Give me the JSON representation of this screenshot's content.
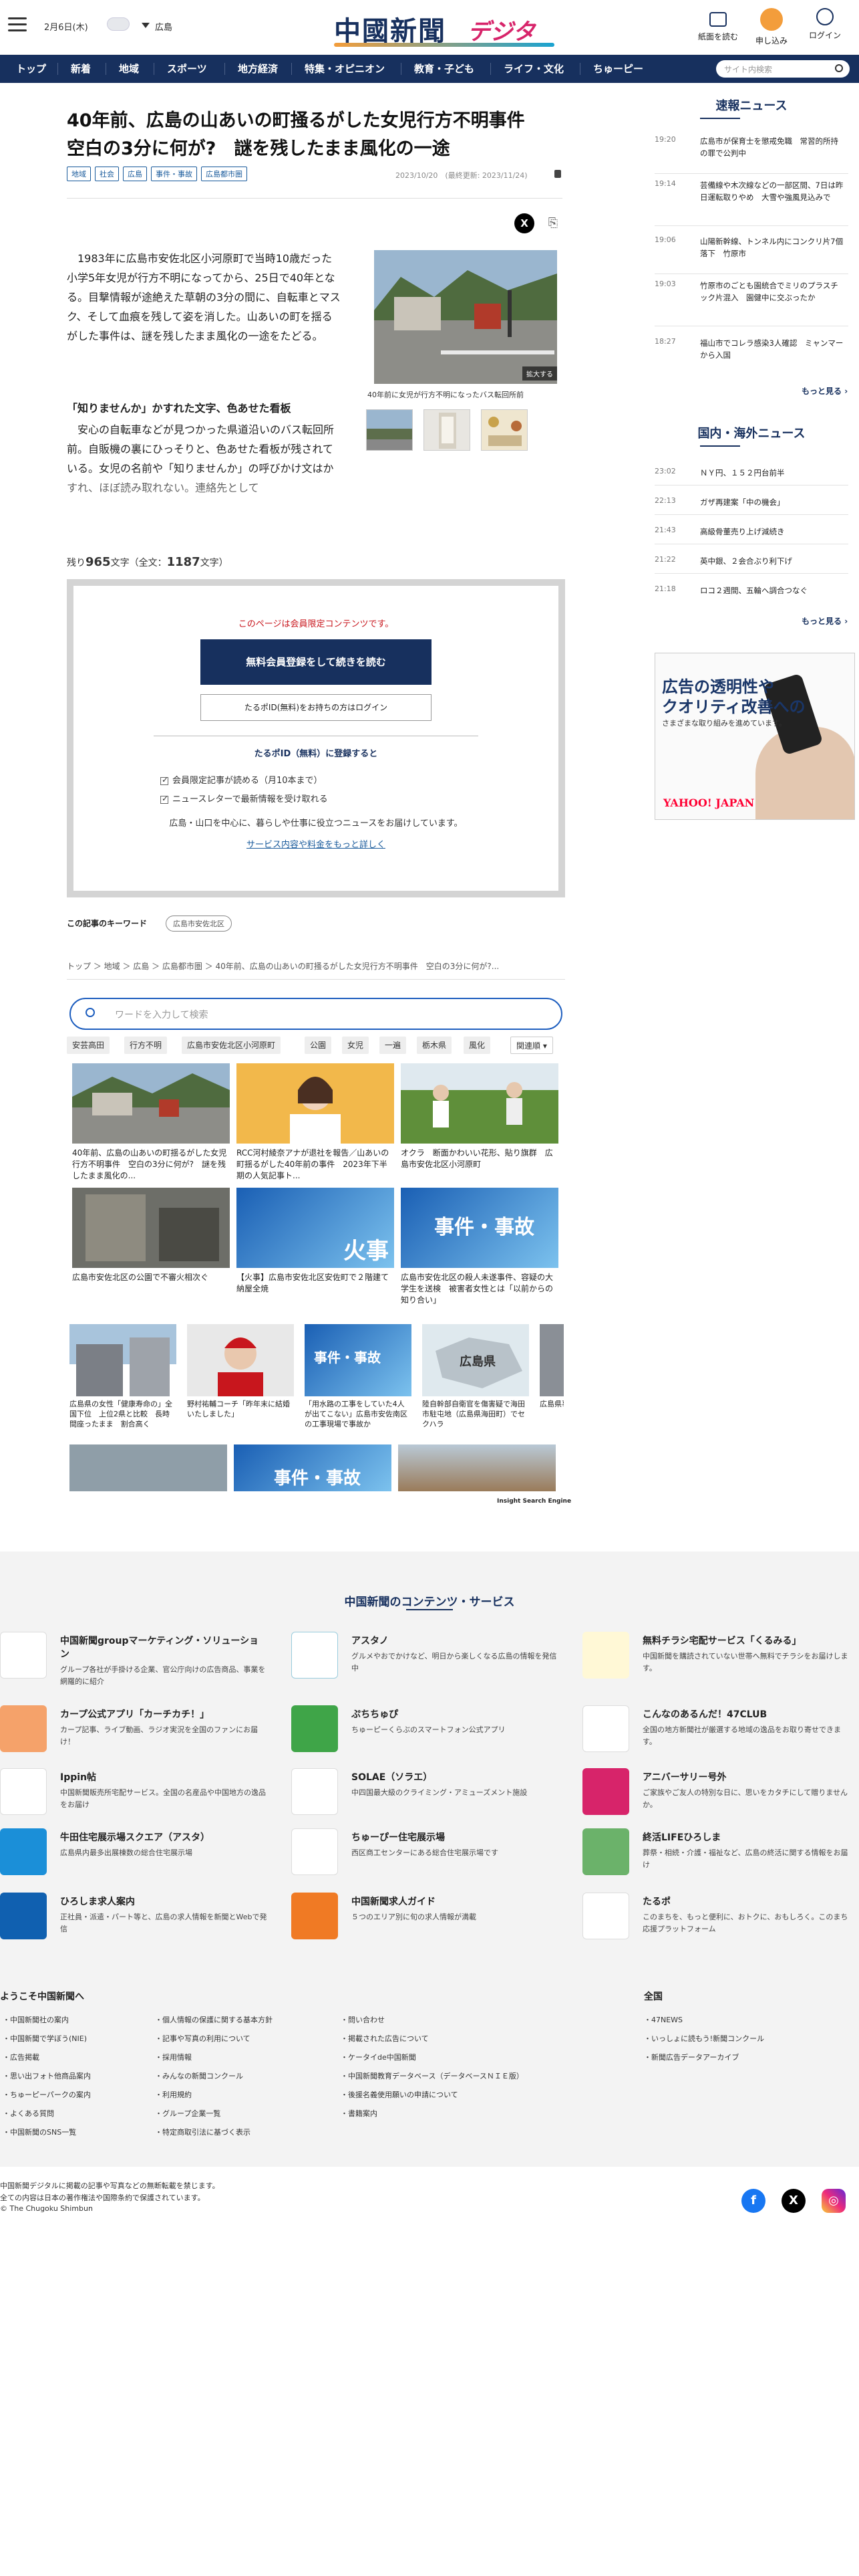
{
  "header": {
    "date": "2月6日(木)",
    "region": "広島",
    "logo_main": "中國新聞",
    "logo_sub": "デジタル",
    "buttons": [
      "紙面を読む",
      "申し込み",
      "ログイン"
    ]
  },
  "nav": {
    "items": [
      "トップ",
      "新着",
      "地域",
      "スポーツ",
      "地方経済",
      "特集・オピニオン",
      "教育・子ども",
      "ライフ・文化",
      "ちゅーピー"
    ],
    "search_placeholder": "サイト内検索"
  },
  "article": {
    "title": "40年前、広島の山あいの町掻るがした女児行方不明事件　空白の3分に何が?　謎を残したまま風化の一途",
    "tags": [
      "地域",
      "社会",
      "広島",
      "事件・事故",
      "広島都市圏"
    ],
    "date": "2023/10/20　(最終更新: 2023/11/24)",
    "lead": "1983年に広島市安佐北区小河原町で当時10歳だった小学5年女児が行方不明になってから、25日で40年となる。目撃情報が途絶えた草朝の3分の間に、自転車とマスク、そして血痕を残して姿を消した。山あいの町を揺るがした事件は、謎を残したまま風化の一途をたどる。",
    "subhead": "「知りませんか」かすれた文字、色あせた看板",
    "body": "安心の自転車などが見つかった県道沿いのバス転回所前。自販機の裏にひっそりと、色あせた看板が残されている。女児の名前や「知りませんか」の呼びかけ文はかすれ、ほぼ読み取れない。連絡先として",
    "photo_caption": "40年前に女児が行方不明になったバス転回所前",
    "zoom_label": "拡大する",
    "remaining_prefix": "残り",
    "remaining_count": "965",
    "remaining_suffix": "文字（全文：",
    "total_count": "1187",
    "total_suffix": "文字）"
  },
  "paywall": {
    "note": "このページは会員限定コンテンツです。",
    "register_button": "無料会員登録をして続きを読む",
    "login_button": "たるポID(無料)をお持ちの方はログイン",
    "heading": "たるポID（無料）に登録すると",
    "benefits": [
      "会員限定記事が読める（月10本まで）",
      "ニュースレターで最新情報を受け取れる"
    ],
    "desc": "広島・山口を中心に、暮らしや仕事に役立つニュースをお届けしています。",
    "link": "サービス内容や料金をもっと詳しく"
  },
  "keywords": {
    "label": "この記事のキーワード",
    "tag": "広島市安佐北区"
  },
  "breadcrumb": "トップ ＞ 地域 ＞ 広島 ＞ 広島都市圏 ＞ 40年前、広島の山あいの町掻るがした女児行方不明事件　空白の3分に何が?...",
  "insight": {
    "placeholder": "ワードを入力して検索",
    "chips": [
      "安芸高田",
      "行方不明",
      "広島市安佐北区小河原町",
      "公園",
      "女児",
      "一遍",
      "栃木県",
      "風化",
      "関連順"
    ],
    "cards": [
      "40年前、広島の山あいの町揺るがした女児行方不明事件　空白の3分に何が?　謎を残したまま風化の...",
      "RCC河村綾奈アナが退社を報告／山あいの町揺るがした40年前の事件　2023年下半期の人気記事ト...",
      "オクラ　断面かわいい花形、貼り旗群　広島市安佐北区小河原町",
      "広島市安佐北区の公園で不審火相次ぐ",
      "【火事】広島市安佐北区安佐町で２階建て納屋全焼",
      "広島市安佐北区の殺人未遂事件、容疑の大学生を送検　被害者女性とは「以前からの知り合い」",
      "広島県の女性「健康寿命の」全国下位　上位2県と比較　長時間座ったまま　割合高く",
      "野村祐輔コーチ「昨年末に結婚いたしました」",
      "「用水路の工事をしていた4人が出てこない」広島市安佐南区の工事現場で事故か",
      "陸自幹部自衛官を傷害疑で海田市駐屯地（広島県海田町）でセクハラ",
      "広島県事態"
    ],
    "overlay_labels": [
      "火事",
      "事件・事故",
      "事件・事故",
      "広島県",
      "事件・事故"
    ],
    "badge": "Insight Search Engine"
  },
  "sidebar": {
    "breaking_title": "速報ニュース",
    "breaking": [
      {
        "time": "19:20",
        "text": "広島市が保育士を懲戒免職　常習的所持の罪で公判中"
      },
      {
        "time": "19:14",
        "text": "芸備線や木次線などの一部区間、7日は昨日運転取りやめ　大雪や強風見込みで"
      },
      {
        "time": "19:06",
        "text": "山陽新幹線、トンネル内にコンクリ片7個落下　竹原市"
      },
      {
        "time": "19:03",
        "text": "竹原市のごとも園統合でミリのプラスチック片混入　園健中に交ぶったか"
      },
      {
        "time": "18:27",
        "text": "福山市でコレラ感染3人確認　ミャンマーから入国"
      }
    ],
    "national_title": "国内・海外ニュース",
    "national": [
      {
        "time": "23:02",
        "text": "ＮＹ円、１５２円台前半"
      },
      {
        "time": "22:13",
        "text": "ガザ再建案「中の機会」"
      },
      {
        "time": "21:43",
        "text": "高級骨董売り上げ減続き"
      },
      {
        "time": "21:22",
        "text": "英中銀、２会合ぶり利下げ"
      },
      {
        "time": "21:18",
        "text": "ロコ２週間、五輪へ調合つなぐ"
      }
    ],
    "more": "もっと見る",
    "ad": {
      "line1": "広告の透明性や",
      "line2": "クオリティ改善への",
      "line3": "さまざまな取り組みを進めています。",
      "brand": "YAHOO! JAPAN"
    }
  },
  "footer": {
    "title": "中国新聞のコンテンツ・サービス",
    "services": [
      {
        "name": "中国新聞groupマーケティング・ソリューション",
        "desc": "グループ各社が手掛ける企業、官公庁向けの広告商品、事業を網羅的に紹介"
      },
      {
        "name": "アスタノ",
        "desc": "グルメやおでかけなど、明日から楽しくなる広島の情報を発信中"
      },
      {
        "name": "無料チラシ宅配サービス「くるみる」",
        "desc": "中国新聞を購読されていない世帯へ無料でチラシをお届けします。"
      },
      {
        "name": "カープ公式アプリ「カーチカチ！」",
        "desc": "カープ記事、ライブ動画、ラジオ実況を全国のファンにお届け！"
      },
      {
        "name": "ぷちちゅぴ",
        "desc": "ちゅーピーくらぶのスマートフォン公式アプリ"
      },
      {
        "name": "こんなのあるんだ！47CLUB",
        "desc": "全国の地方新聞社が厳選する地域の逸品をお取り寄せできます。"
      },
      {
        "name": "Ippin帖",
        "desc": "中国新聞販売所宅配サービス。全国の名産品や中国地方の逸品をお届け"
      },
      {
        "name": "SOLAE（ソラエ）",
        "desc": "中四国最大級のクライミング・アミューズメント施設"
      },
      {
        "name": "アニバーサリー号外",
        "desc": "ご家族やご友人の特別な日に、思いをカタチにして贈りませんか。"
      },
      {
        "name": "牛田住宅展示場スクエア（アスタ）",
        "desc": "広島県内最多出展棟数の総合住宅展示場"
      },
      {
        "name": "ちゅーぴー住宅展示場",
        "desc": "西区商工センターにある総合住宅展示場です"
      },
      {
        "name": "終活LIFEひろしま",
        "desc": "葬祭・相続・介護・福祉など、広島の終活に関する情報をお届け"
      },
      {
        "name": "ひろしま求人案内",
        "desc": "正社員・派遣・パート等と、広島の求人情報を新聞とWebで発信"
      },
      {
        "name": "中国新聞求人ガイド",
        "desc": "５つのエリア別に旬の求人情報が満載"
      },
      {
        "name": "たるポ",
        "desc": "このまちを、もっと便利に、おトクに、おもしろく。このまち応援プラットフォーム"
      }
    ],
    "welcome": "ようこそ中国新聞へ",
    "col1": [
      "中国新聞社の案内",
      "中国新聞で学ぼう(NIE)",
      "広告掲載",
      "思い出フォト他商品案内",
      "ちゅーピーパークの案内",
      "よくある質問",
      "中国新聞のSNS一覧"
    ],
    "col2": [
      "個人情報の保護に関する基本方針",
      "記事や写真の利用について",
      "採用情報",
      "みんなの新聞コンクール",
      "利用規約",
      "グループ企業一覧",
      "特定商取引法に基づく表示"
    ],
    "col3": [
      "問い合わせ",
      "掲載された広告について",
      "ケータイde中国新聞",
      "中国新聞教育データベース（データベースＮＩＥ版）",
      "後援名義使用願いの申請について",
      "書籍案内"
    ],
    "global_title": "全国",
    "col4": [
      "47NEWS",
      "いっしょに読もう!新聞コンクール",
      "新聞広告データアーカイブ"
    ],
    "copy1": "中国新聞デジタルに掲載の記事や写真などの無断転載を禁じます。",
    "copy2": "全ての内容は日本の著作権法や国際条約で保護されています。",
    "copy3": "© The Chugoku Shimbun"
  },
  "colors": {
    "navy": "#17305e",
    "accent": "#d7246a",
    "red": "#c8161d"
  }
}
